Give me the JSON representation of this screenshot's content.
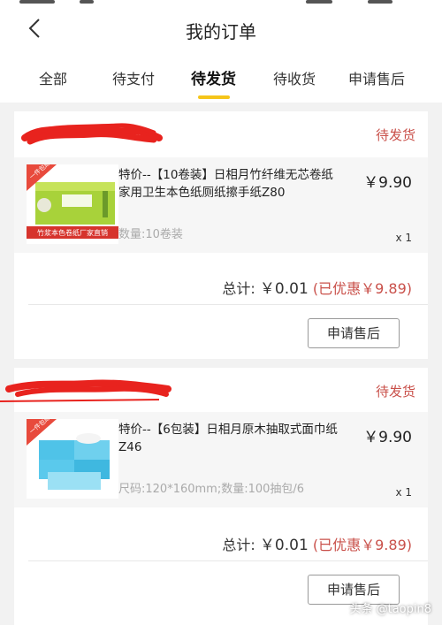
{
  "header": {
    "title": "我的订单"
  },
  "tabs": [
    {
      "label": "全部"
    },
    {
      "label": "待支付"
    },
    {
      "label": "待发货",
      "active": true
    },
    {
      "label": "待收货"
    },
    {
      "label": "申请售后"
    }
  ],
  "orders": [
    {
      "status": "待发货",
      "product": {
        "name": "特价--【10卷装】日相月竹纤维无芯卷纸家用卫生本色纸厕纸擦手纸Z80",
        "price": "￥9.90",
        "spec": "数量:10卷装",
        "qty": "x 1",
        "thumb_badge": "一件包邮",
        "thumb_banner": "竹浆本色卷纸厂家直销"
      },
      "total_label": "总计:",
      "total_amount": "￥0.01",
      "discount": "(已优惠￥9.89)",
      "button_label": "申请售后"
    },
    {
      "status": "待发货",
      "product": {
        "name": "特价--【6包装】日相月原木抽取式面巾纸Z46",
        "price": "￥9.90",
        "spec": "尺码:120*160mm;数量:100抽包/6",
        "qty": "x 1",
        "thumb_badge": "一件包邮"
      },
      "total_label": "总计:",
      "total_amount": "￥0.01",
      "discount": "(已优惠￥9.89)",
      "button_label": "申请售后"
    }
  ],
  "watermark": "头条 @taopin8",
  "colors": {
    "accent": "#f5c51a",
    "status_red": "#c9504a",
    "scribble_red": "#e8231e"
  }
}
